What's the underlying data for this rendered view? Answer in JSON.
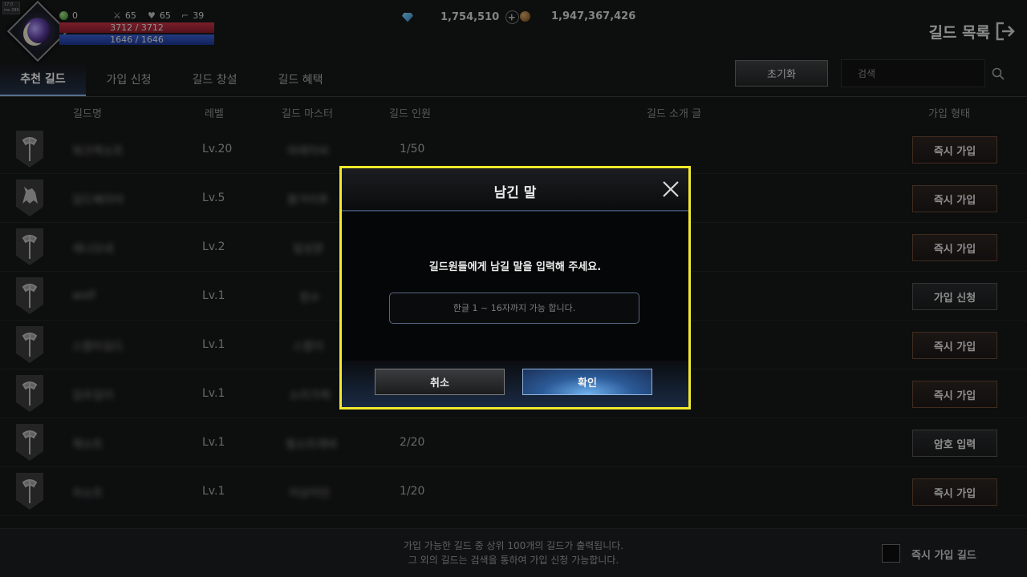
{
  "hud": {
    "tiny_label": "17.0 ms 299 fps",
    "gem_count": "0",
    "attack": "65",
    "defense": "65",
    "speed": "39",
    "hp": "3712 / 3712",
    "mp": "1646 / 1646",
    "diamonds": "1,754,510",
    "gold": "1,947,367,426",
    "page_title": "길드 목록"
  },
  "tabs": [
    "추천 길드",
    "가입 신청",
    "길드 창설",
    "길드 혜택"
  ],
  "toolbar": {
    "reset_label": "초기화",
    "search_placeholder": "검색"
  },
  "table": {
    "headers": [
      "길드명",
      "레벨",
      "길드 마스터",
      "길드 인원",
      "길드 소개 글",
      "가입 형태"
    ],
    "rows": [
      {
        "name": "워크렉소트",
        "level": "Lv.20",
        "master": "마레이씨",
        "members": "1/50",
        "join": "즉시 가입"
      },
      {
        "name": "길드베리아",
        "level": "Lv.5",
        "master": "붉거이후",
        "members": "",
        "join": "즉시 가입"
      },
      {
        "name": "세나오네",
        "level": "Lv.2",
        "master": "일상운",
        "members": "",
        "join": "즉시 가입"
      },
      {
        "name": "wolf",
        "level": "Lv.1",
        "master": "정수",
        "members": "",
        "join": "가입 신청"
      },
      {
        "name": "스팜미길드",
        "level": "Lv.1",
        "master": "스팜이",
        "members": "",
        "join": "즉시 가입"
      },
      {
        "name": "길우길이",
        "level": "Lv.1",
        "master": "소리가제",
        "members": "",
        "join": "즉시 가입"
      },
      {
        "name": "재소트",
        "level": "Lv.1",
        "master": "필소트레바",
        "members": "2/20",
        "join": "암호 입력"
      },
      {
        "name": "자소트",
        "level": "Lv.1",
        "master": "이상이인",
        "members": "1/20",
        "join": "즉시 가입"
      }
    ]
  },
  "footer": {
    "note_line1": "가입 가능한 길드 중 상위 100개의 길드가 출력됩니다.",
    "note_line2": "그 외의 길드는 검색을 통하여 가입 신청 가능합니다.",
    "checkbox_label": "즉시 가입 길드"
  },
  "modal": {
    "title": "남긴 말",
    "message": "길드원들에게 남길 말을 입력해 주세요.",
    "input_placeholder": "한글 1 ~ 16자까지 가능 합니다.",
    "cancel_label": "취소",
    "confirm_label": "확인",
    "highlight_color": "#f2ea2b"
  }
}
